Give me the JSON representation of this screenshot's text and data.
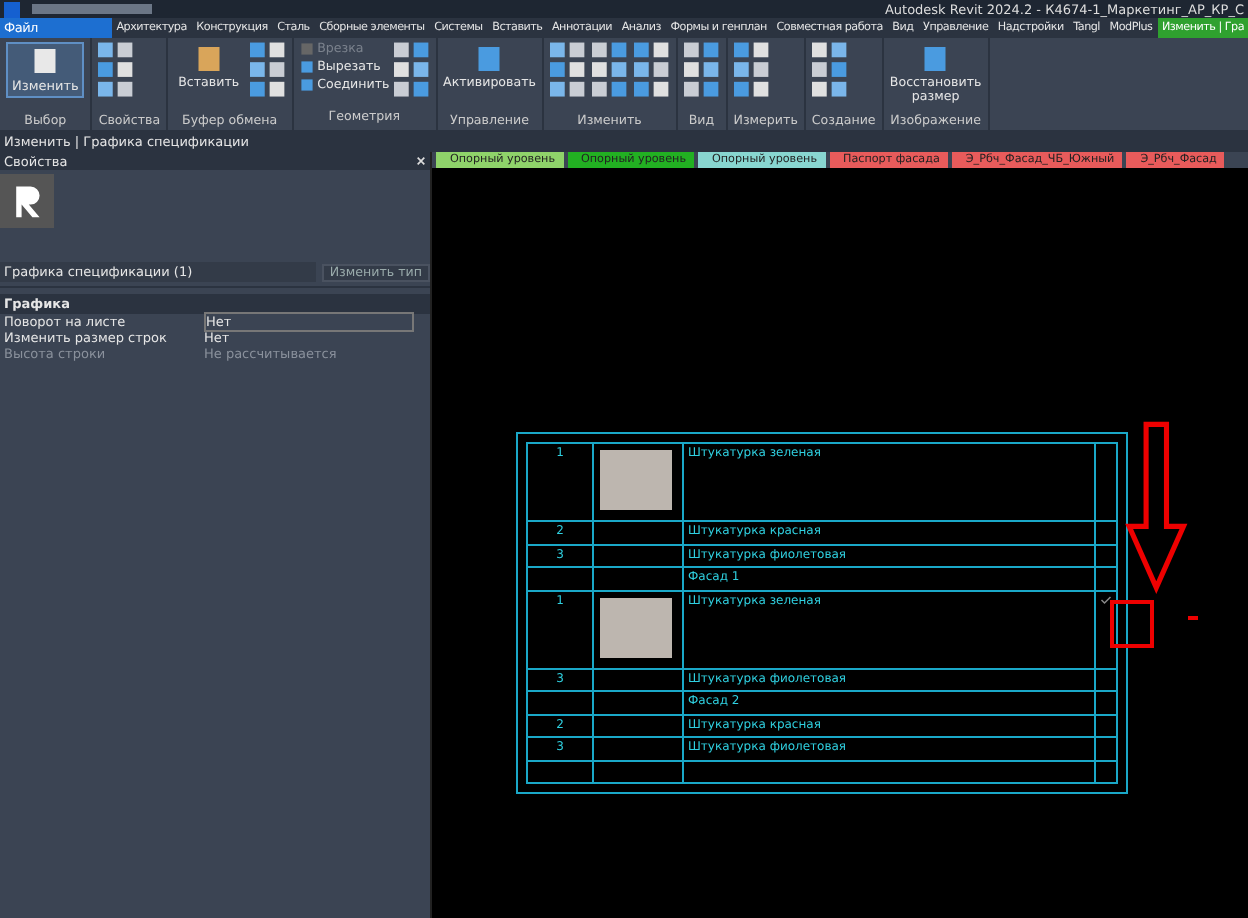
{
  "window": {
    "title": "Autodesk Revit 2024.2 - К4674-1_Маркетинг_АР_КР_С"
  },
  "tabs": [
    {
      "label": "Файл",
      "selected": true,
      "kind": "file"
    },
    {
      "label": "Архитектура",
      "selected": false,
      "kind": "tab"
    },
    {
      "label": "Конструкция",
      "selected": false,
      "kind": "tab"
    },
    {
      "label": "Сталь",
      "selected": false,
      "kind": "tab"
    },
    {
      "label": "Сборные элементы",
      "selected": false,
      "kind": "tab"
    },
    {
      "label": "Системы",
      "selected": false,
      "kind": "tab"
    },
    {
      "label": "Вставить",
      "selected": false,
      "kind": "tab"
    },
    {
      "label": "Аннотации",
      "selected": false,
      "kind": "tab"
    },
    {
      "label": "Анализ",
      "selected": false,
      "kind": "tab"
    },
    {
      "label": "Формы и генплан",
      "selected": false,
      "kind": "tab"
    },
    {
      "label": "Совместная работа",
      "selected": false,
      "kind": "tab"
    },
    {
      "label": "Вид",
      "selected": false,
      "kind": "tab"
    },
    {
      "label": "Управление",
      "selected": false,
      "kind": "tab"
    },
    {
      "label": "Надстройки",
      "selected": false,
      "kind": "tab"
    },
    {
      "label": "Tangl",
      "selected": false,
      "kind": "tab"
    },
    {
      "label": "ModPlus",
      "selected": false,
      "kind": "tab"
    },
    {
      "label": "Изменить | Гра",
      "selected": false,
      "kind": "context"
    }
  ],
  "ribbon": [
    {
      "title": "Выбор",
      "tools": [
        {
          "kind": "large",
          "label": "Изменить",
          "selected": true
        }
      ]
    },
    {
      "title": "Свойства",
      "tools": [
        {
          "kind": "icons"
        }
      ]
    },
    {
      "title": "Буфер обмена",
      "tools": [
        {
          "kind": "large",
          "label": "Вставить",
          "selected": false
        },
        {
          "kind": "icons"
        }
      ]
    },
    {
      "title": "Геометрия",
      "tools": [
        {
          "kind": "small",
          "label": "Врезка",
          "disabled": true
        },
        {
          "kind": "small",
          "label": "Вырезать",
          "disabled": false
        },
        {
          "kind": "small",
          "label": "Соединить",
          "disabled": false
        },
        {
          "kind": "icons"
        }
      ]
    },
    {
      "title": "Управление",
      "tools": [
        {
          "kind": "large",
          "label": "Активировать",
          "selected": false
        }
      ]
    },
    {
      "title": "Изменить",
      "tools": [
        {
          "kind": "icons"
        },
        {
          "kind": "icons"
        },
        {
          "kind": "icons"
        }
      ]
    },
    {
      "title": "Вид",
      "tools": [
        {
          "kind": "icons"
        }
      ]
    },
    {
      "title": "Измерить",
      "tools": [
        {
          "kind": "icons"
        }
      ]
    },
    {
      "title": "Создание",
      "tools": [
        {
          "kind": "icons"
        }
      ]
    },
    {
      "title": "Изображение",
      "tools": [
        {
          "kind": "large",
          "label": "Восстановить размер",
          "selected": false
        }
      ]
    }
  ],
  "context_bar": "Изменить | Графика спецификации",
  "properties": {
    "title": "Свойства",
    "type_selector": "Графика спецификации (1)",
    "edit_type": "Изменить тип",
    "group": "Графика",
    "rows": [
      {
        "name": "Поворот на листе",
        "value": "Нет",
        "disabled": false
      },
      {
        "name": "Изменить размер строк",
        "value": "Нет",
        "disabled": false
      },
      {
        "name": "Высота строки",
        "value": "Не рассчитывается",
        "disabled": true
      }
    ]
  },
  "view_tabs": [
    {
      "label": "Опорный уровень",
      "color": "#8fd36a"
    },
    {
      "label": "Опорный уровень",
      "color": "#22b022"
    },
    {
      "label": "Опорный уровень",
      "color": "#88d6d0"
    },
    {
      "label": "Паспорт фасада",
      "color": "#e85b5b"
    },
    {
      "label": "Э_Рбч_Фасад_ЧБ_Южный",
      "color": "#e85b5b"
    },
    {
      "label": "Э_Рбч_Фасад",
      "color": "#e85b5b"
    }
  ],
  "schedule": {
    "rows": [
      {
        "kind": "item",
        "number": "1",
        "swatch": true,
        "name": "Штукатурка зеленая",
        "marked": false
      },
      {
        "kind": "item",
        "number": "2",
        "swatch": false,
        "name": "Штукатурка красная",
        "marked": false
      },
      {
        "kind": "item",
        "number": "3",
        "swatch": false,
        "name": "Штукатурка фиолетовая",
        "marked": false
      },
      {
        "kind": "group",
        "name": "Фасад 1"
      },
      {
        "kind": "item",
        "number": "1",
        "swatch": true,
        "name": "Штукатурка зеленая",
        "marked": true
      },
      {
        "kind": "item",
        "number": "3",
        "swatch": false,
        "name": "Штукатурка фиолетовая",
        "marked": false
      },
      {
        "kind": "group",
        "name": "Фасад 2"
      },
      {
        "kind": "item",
        "number": "2",
        "swatch": false,
        "name": "Штукатурка красная",
        "marked": false
      },
      {
        "kind": "item",
        "number": "3",
        "swatch": false,
        "name": "Штукатурка фиолетовая",
        "marked": false
      },
      {
        "kind": "blank"
      }
    ]
  }
}
